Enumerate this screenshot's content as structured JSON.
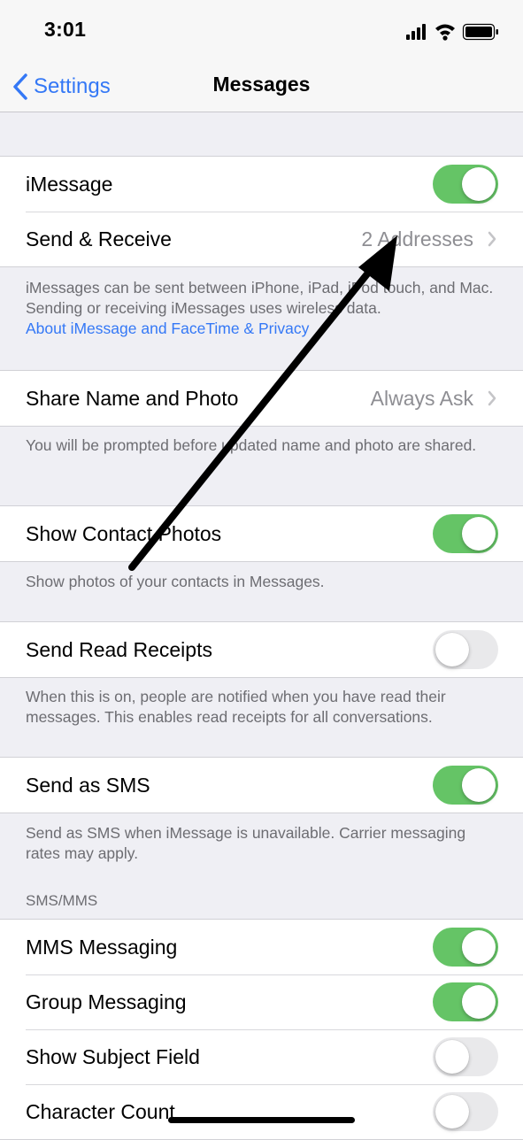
{
  "status_bar": {
    "time": "3:01",
    "icons": [
      "cellular-signal-icon",
      "wifi-icon",
      "battery-icon"
    ]
  },
  "nav": {
    "back_label": "Settings",
    "title": "Messages"
  },
  "colors": {
    "accent": "#3478f6",
    "toggle_on": "#65c466",
    "toggle_off": "#e9e9eb",
    "background": "#efeff4",
    "secondary_text": "#8e8e93"
  },
  "groups": {
    "imessage": {
      "toggle_row": {
        "label": "iMessage",
        "state": "on"
      },
      "send_receive": {
        "label": "Send & Receive",
        "value": "2 Addresses"
      },
      "footer_text": "iMessages can be sent between iPhone, iPad, iPod touch, and Mac. Sending or receiving iMessages uses wireless data.",
      "footer_link": "About iMessage and FaceTime & Privacy"
    },
    "share": {
      "label": "Share Name and Photo",
      "value": "Always Ask",
      "footer": "You will be prompted before updated name and photo are shared."
    },
    "contact_photos": {
      "label": "Show Contact Photos",
      "state": "on",
      "footer": "Show photos of your contacts in Messages."
    },
    "read_receipts": {
      "label": "Send Read Receipts",
      "state": "off",
      "footer": "When this is on, people are notified when you have read their messages. This enables read receipts for all conversations."
    },
    "sms": {
      "label": "Send as SMS",
      "state": "on",
      "footer": "Send as SMS when iMessage is unavailable. Carrier messaging rates may apply."
    },
    "sms_mms": {
      "header": "SMS/MMS",
      "rows": [
        {
          "label": "MMS Messaging",
          "state": "on"
        },
        {
          "label": "Group Messaging",
          "state": "on"
        },
        {
          "label": "Show Subject Field",
          "state": "off"
        },
        {
          "label": "Character Count",
          "state": "off"
        }
      ]
    }
  },
  "annotation": {
    "type": "arrow",
    "color": "#000000"
  }
}
